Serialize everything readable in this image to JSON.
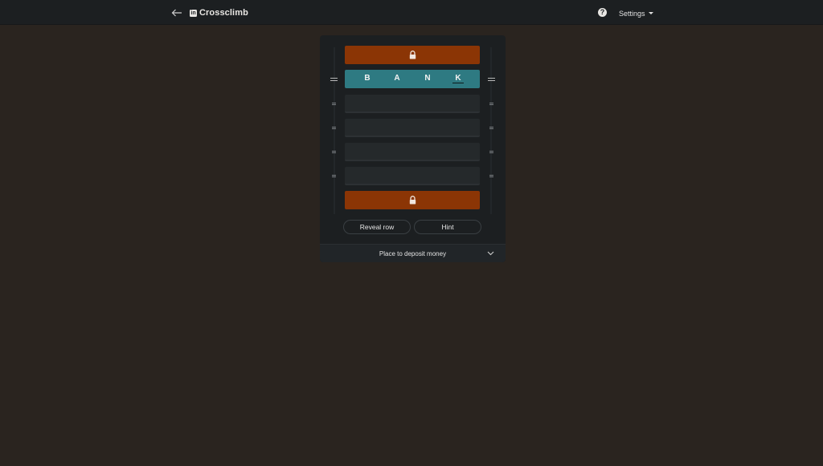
{
  "header": {
    "brand_logo": "in",
    "title": "Crossclimb",
    "help_glyph": "?",
    "settings_label": "Settings"
  },
  "board": {
    "active_word": [
      "B",
      "A",
      "N",
      "K"
    ],
    "clue": "Place to deposit money"
  },
  "actions": {
    "reveal_label": "Reveal row",
    "hint_label": "Hint"
  },
  "colors": {
    "locked_row": "#8b3505",
    "active_row": "#2e7a82",
    "empty_row": "#25292b",
    "background": "#2a241f",
    "card": "#1c1f21"
  },
  "icons": {
    "back": "arrow-left-icon",
    "brand": "linkedin-icon",
    "help": "question-circle-icon",
    "settings_caret": "caret-down-icon",
    "lock": "lock-icon",
    "drag": "drag-handle-icon",
    "expand": "chevron-down-icon"
  }
}
